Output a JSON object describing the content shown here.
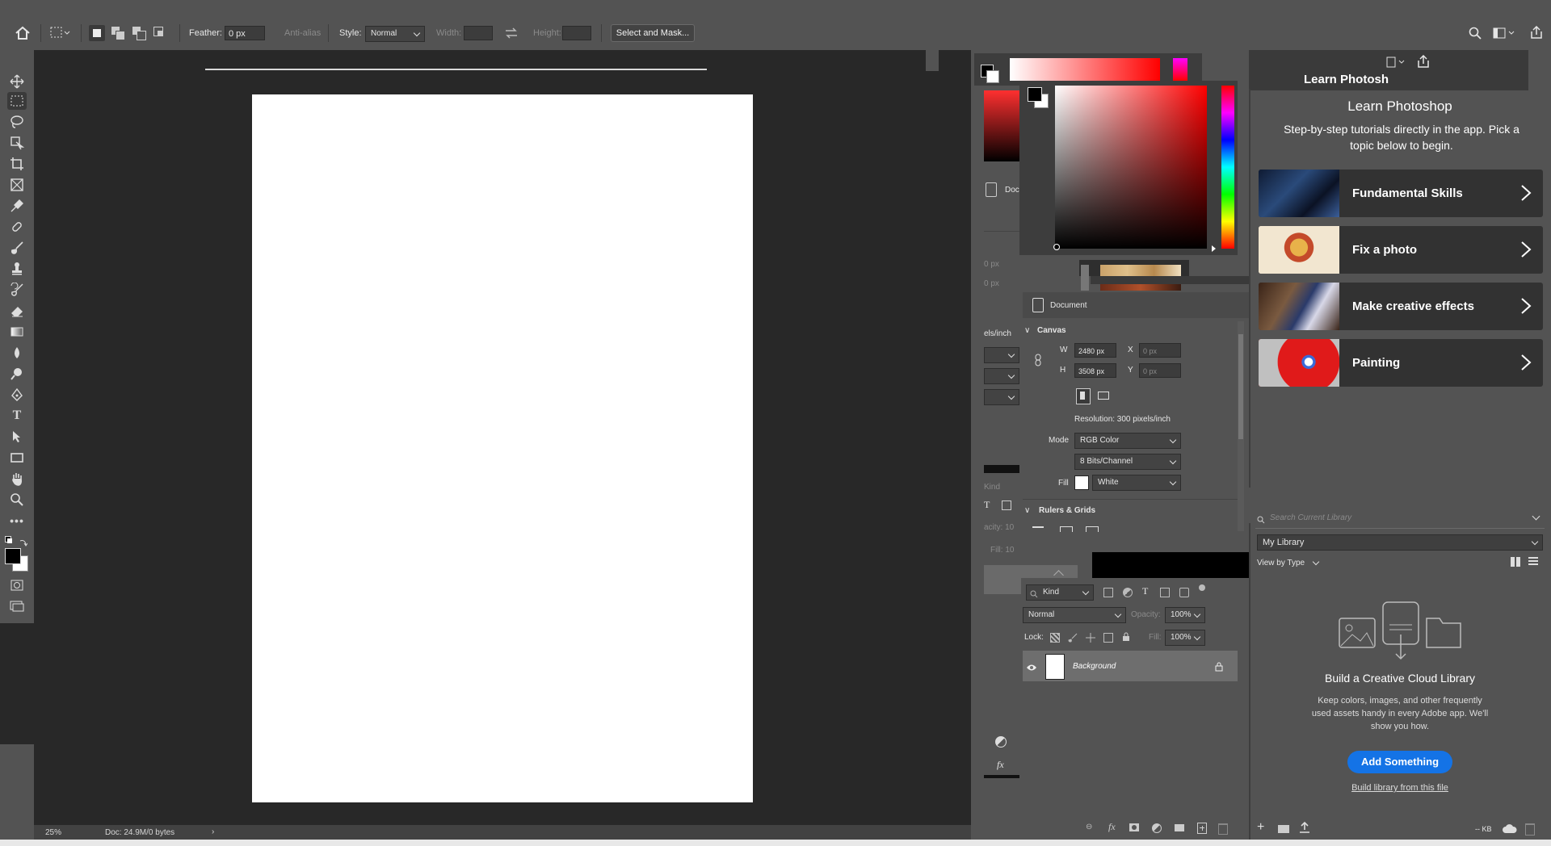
{
  "options_bar": {
    "feather_label": "Feather:",
    "feather_value": "0 px",
    "anti_alias_label": "Anti-alias",
    "style_label": "Style:",
    "style_value": "Normal",
    "width_label": "Width:",
    "height_label": "Height:",
    "select_mask_label": "Select and Mask..."
  },
  "status_bar": {
    "zoom": "25%",
    "doc_info": "Doc: 24.9M/0 bytes"
  },
  "color_picker_behind": {
    "doc_label": "Doc",
    "px1": "0 px",
    "px2": "0 px",
    "els_inch": "els/inch",
    "kind": "Kind",
    "opacity_frag": "acity:",
    "opacity_val": "10",
    "fill_frag": "Fill:",
    "fill_val": "10"
  },
  "properties": {
    "document_label": "Document",
    "canvas_label": "Canvas",
    "w_label": "W",
    "w_value": "2480 px",
    "h_label": "H",
    "h_value": "3508 px",
    "x_label": "X",
    "x_value": "0 px",
    "y_label": "Y",
    "y_value": "0 px",
    "resolution": "Resolution: 300 pixels/inch",
    "mode_label": "Mode",
    "mode_value": "RGB Color",
    "bits_value": "8 Bits/Channel",
    "fill_label": "Fill",
    "fill_value": "White",
    "rulers_label": "Rulers & Grids"
  },
  "layers": {
    "kind_label": "Kind",
    "blend_mode": "Normal",
    "opacity_label": "Opacity:",
    "opacity_value": "100%",
    "lock_label": "Lock:",
    "fill_label": "Fill:",
    "fill_value": "100%",
    "layer_name": "Background"
  },
  "learn": {
    "partial_title": "Learn Photosh",
    "title": "Learn Photoshop",
    "subtitle": "Step-by-step tutorials directly in the app. Pick a topic below to begin.",
    "cards": [
      {
        "title": "Fundamental Skills"
      },
      {
        "title": "Fix a photo"
      },
      {
        "title": "Make creative effects"
      },
      {
        "title": "Painting"
      }
    ]
  },
  "libraries": {
    "search_placeholder": "Search Current Library",
    "library_select": "My Library",
    "view_by": "View by Type",
    "build_title": "Build a Creative Cloud Library",
    "build_desc": "Keep colors, images, and other frequently used assets handy in every Adobe app. We'll show you how.",
    "add_button": "Add Something",
    "build_link": "Build library from this file",
    "kb": "-- KB"
  },
  "colors": {
    "accent_blue": "#1473e6",
    "panel_bg": "#535353",
    "canvas_bg": "#282828"
  },
  "icons": [
    "home-icon",
    "marquee-icon",
    "move-icon",
    "lasso-icon",
    "crop-icon",
    "eyedropper-icon",
    "brush-icon",
    "eraser-icon",
    "type-icon",
    "hand-icon",
    "zoom-icon",
    "search-icon",
    "share-icon",
    "eye-icon",
    "lock-icon",
    "trash-icon"
  ]
}
